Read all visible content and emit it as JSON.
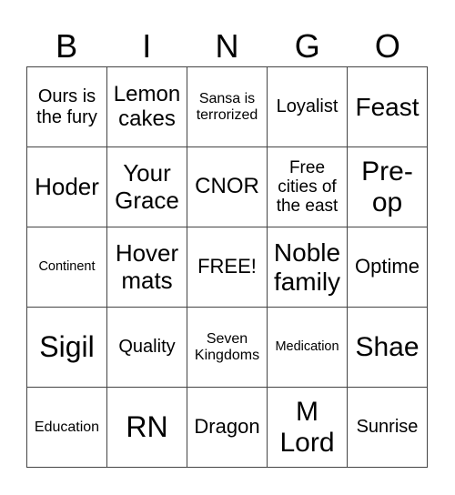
{
  "header": {
    "letters": [
      "B",
      "I",
      "N",
      "G",
      "O"
    ]
  },
  "cells": [
    [
      "Ours is the fury",
      "Lemon cakes",
      "Sansa is terrorized",
      "Loyalist",
      "Feast"
    ],
    [
      "Hoder",
      "Your Grace",
      "CNOR",
      "Free cities of the east",
      "Pre-op"
    ],
    [
      "Continent",
      "Hover mats",
      "FREE!",
      "Noble family",
      "Optime"
    ],
    [
      "Sigil",
      "Quality",
      "Seven Kingdoms",
      "Medication",
      "Shae"
    ],
    [
      "Education",
      "RN",
      "Dragon",
      "M Lord",
      "Sunrise"
    ]
  ]
}
